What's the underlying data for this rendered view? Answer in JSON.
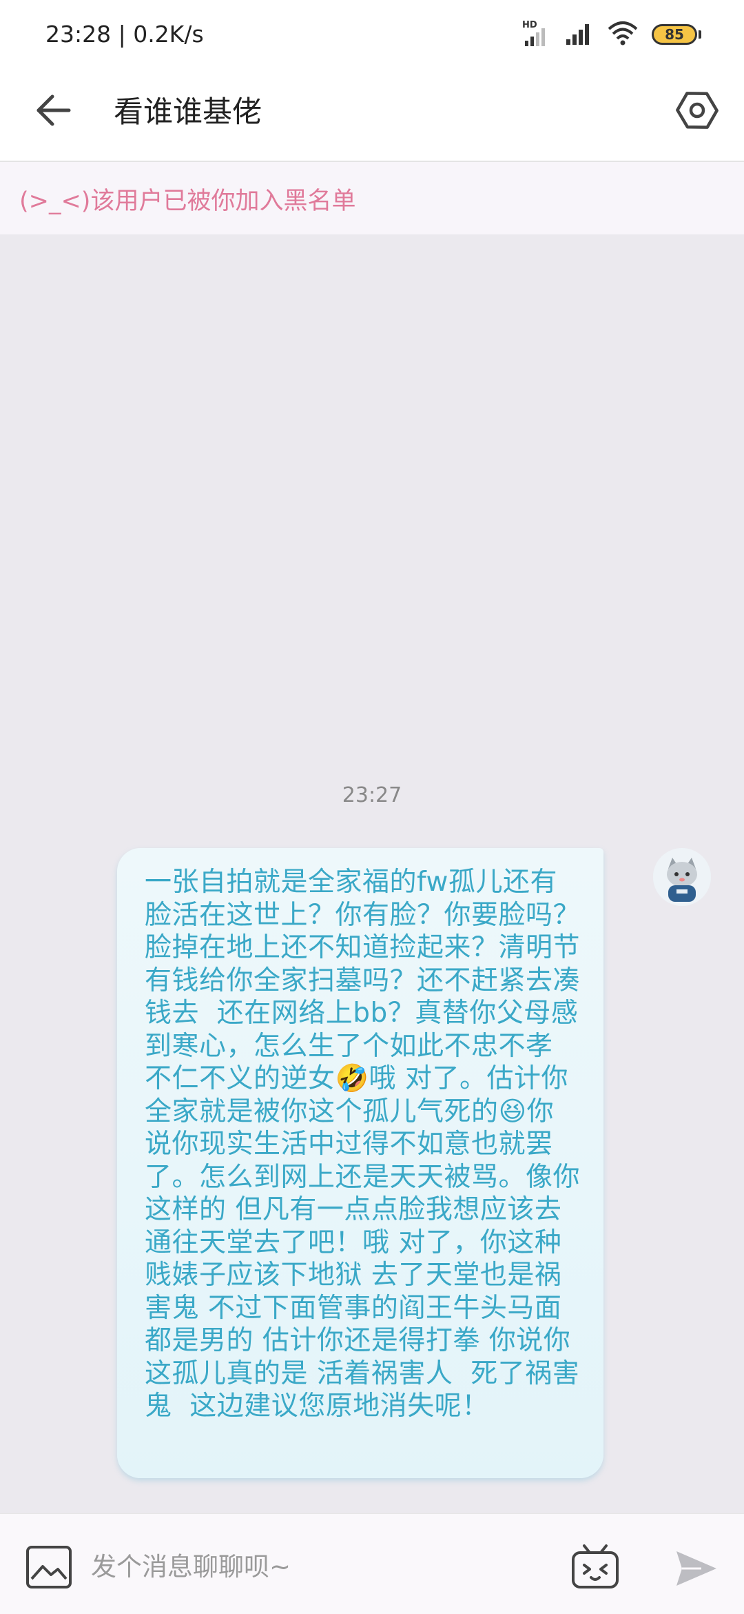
{
  "status_bar": {
    "time": "23:28 | 0.2K/s",
    "hd_label": "HD",
    "battery": "85",
    "icons": [
      "hd-signal-icon",
      "signal-icon",
      "wifi-icon",
      "battery-icon"
    ]
  },
  "header": {
    "title": "看谁谁基佬",
    "back_icon": "arrow-left-icon",
    "settings_icon": "hexagon-settings-icon"
  },
  "notice": {
    "text": "(>_<)该用户已被你加入黑名单"
  },
  "chat": {
    "timestamp": "23:27",
    "messages": [
      {
        "sender": "self",
        "text": "一张自拍就是全家福的fw孤儿还有脸活在这世上？你有脸？你要脸吗？脸掉在地上还不知道捡起来？清明节有钱给你全家扫墓吗？还不赶紧去凑钱去  还在网络上bb？真替你父母感到寒心，怎么生了个如此不忠不孝  不仁不义的逆女🤣哦 对了。估计你全家就是被你这个孤儿气死的😆你说你现实生活中过得不如意也就罢了。怎么到网上还是天天被骂。像你这样的 但凡有一点点脸我想应该去通往天堂去了吧！哦 对了，你这种贱婊子应该下地狱 去了天堂也是祸害鬼 不过下面管事的阎王牛头马面都是男的 估计你还是得打拳 你说你这孤儿真的是 活着祸害人  死了祸害鬼  这边建议您原地消失呢！"
      }
    ]
  },
  "input_bar": {
    "placeholder": "发个消息聊聊呗~",
    "image_icon": "image-icon",
    "emoji_icon": "tv-emoji-icon",
    "send_icon": "send-icon"
  },
  "colors": {
    "notice_text": "#e07a9a",
    "bubble_text": "#3aa8c7",
    "bubble_bg": "#e8f6fa",
    "chat_bg": "#ebe9ee",
    "battery_fill": "#f6c445"
  }
}
